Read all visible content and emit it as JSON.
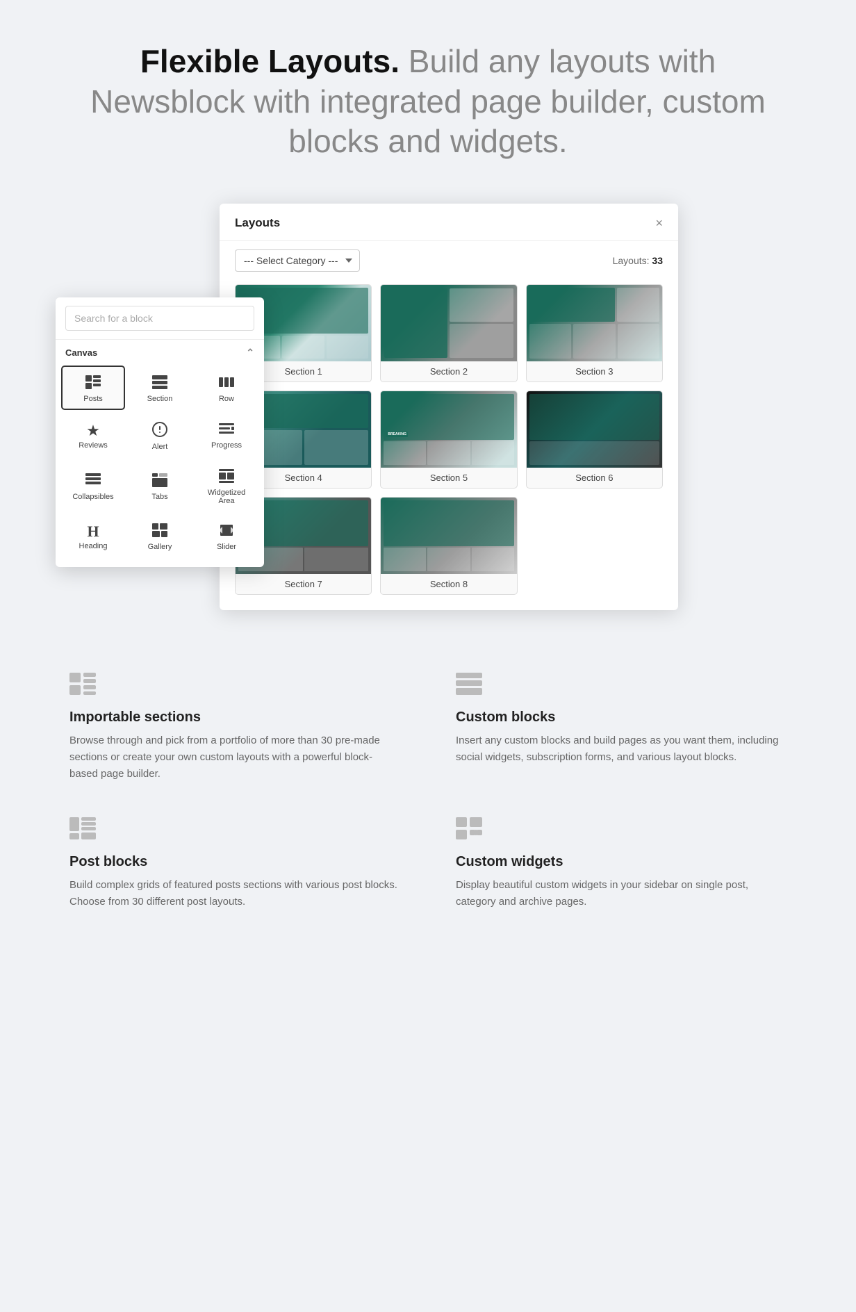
{
  "hero": {
    "heading_strong": "Flexible Layouts.",
    "heading_rest": " Build any layouts with Newsblock with integrated page builder, custom blocks and widgets."
  },
  "modal": {
    "title": "Layouts",
    "close_label": "×",
    "category_placeholder": "--- Select Category ---",
    "layouts_count_label": "Layouts:",
    "layouts_count_value": "33",
    "cards": [
      {
        "label": "Section 1"
      },
      {
        "label": "Section 2"
      },
      {
        "label": "Section 3"
      },
      {
        "label": "Section 4"
      },
      {
        "label": "Section 5"
      },
      {
        "label": "Section 6"
      },
      {
        "label": "Section 7"
      },
      {
        "label": "Section 8"
      }
    ]
  },
  "block_panel": {
    "search_placeholder": "Search for a block",
    "section_label": "Canvas",
    "blocks": [
      {
        "id": "posts",
        "label": "Posts",
        "icon": "▦",
        "active": true
      },
      {
        "id": "section",
        "label": "Section",
        "icon": "⊟"
      },
      {
        "id": "row",
        "label": "Row",
        "icon": "⊞"
      },
      {
        "id": "reviews",
        "label": "Reviews",
        "icon": "★"
      },
      {
        "id": "alert",
        "label": "Alert",
        "icon": "⊙"
      },
      {
        "id": "progress",
        "label": "Progress",
        "icon": "≡"
      },
      {
        "id": "collapsibles",
        "label": "Collapsibles",
        "icon": "≡"
      },
      {
        "id": "tabs",
        "label": "Tabs",
        "icon": "◱"
      },
      {
        "id": "widgetized",
        "label": "Widgetized Area",
        "icon": "⊞"
      },
      {
        "id": "heading",
        "label": "Heading",
        "icon": "H"
      },
      {
        "id": "gallery",
        "label": "Gallery",
        "icon": "⊞"
      },
      {
        "id": "slider",
        "label": "Slider",
        "icon": "◫"
      }
    ]
  },
  "features": [
    {
      "id": "importable-sections",
      "icon_type": "sections",
      "title": "Importable sections",
      "description": "Browse through and pick from a portfolio of more than 30 pre-made sections or create your own custom layouts with a powerful block-based page builder."
    },
    {
      "id": "custom-blocks",
      "icon_type": "blocks",
      "title": "Custom blocks",
      "description": "Insert any custom blocks and build pages as you want them, including social widgets, subscription forms, and various layout blocks."
    },
    {
      "id": "post-blocks",
      "icon_type": "post-blocks",
      "title": "Post blocks",
      "description": "Build complex grids of featured posts sections with various post blocks. Choose from 30 different post layouts."
    },
    {
      "id": "custom-widgets",
      "icon_type": "widgets",
      "title": "Custom widgets",
      "description": "Display beautiful custom widgets in your sidebar on single post, category and archive pages."
    }
  ]
}
